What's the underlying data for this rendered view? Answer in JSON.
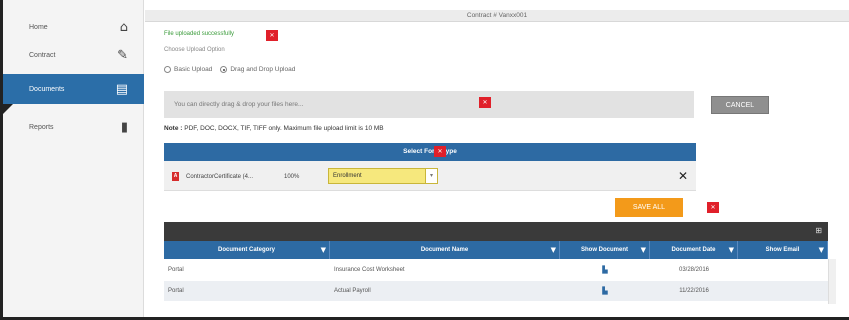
{
  "sidebar": {
    "items": [
      {
        "label": "Home",
        "icon": "home-icon"
      },
      {
        "label": "Contract",
        "icon": "pencil-icon"
      },
      {
        "label": "Documents",
        "icon": "document-icon"
      },
      {
        "label": "Reports",
        "icon": "bar-chart-icon"
      }
    ]
  },
  "header": {
    "title": "Contract # Vanxx001"
  },
  "upload": {
    "success_message": "File uploaded successfully",
    "choose_label": "Choose Upload Option",
    "options": [
      "Basic Upload",
      "Drag and Drop Upload"
    ],
    "selected_option": "Drag and Drop Upload",
    "dropzone_text": "You can directly drag & drop your files here...",
    "cancel_label": "CANCEL",
    "note_label": "Note :",
    "note_text": "PDF, DOC, DOCX, TIF, TIFF only. Maximum file upload limit is 10 MB"
  },
  "form_type": {
    "header": "Select Form Type",
    "file_name": "ContractorCertificate (4...",
    "file_percent": "100%",
    "selected_type": "Enrollment"
  },
  "save_all_label": "SAVE ALL",
  "grid": {
    "columns": [
      "Document Category",
      "Document Name",
      "Show Document",
      "Document Date",
      "Show Email"
    ],
    "rows": [
      {
        "category": "Portal",
        "name": "Insurance Cost Worksheet",
        "date": "03/28/2016",
        "email": ""
      },
      {
        "category": "Portal",
        "name": "Actual Payroll",
        "date": "11/22/2016",
        "email": ""
      }
    ]
  },
  "colors": {
    "primary": "#2d6aa3",
    "accent": "#f39a1a",
    "danger": "#e0202a",
    "success": "#3a9b3a",
    "highlight": "#f6e87d"
  }
}
